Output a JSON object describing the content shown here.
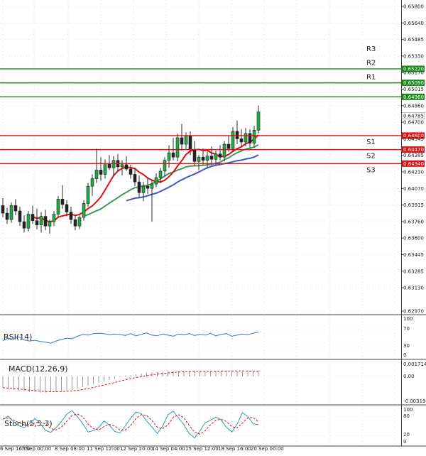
{
  "chart_data": {
    "type": "candlestick",
    "price_axis": {
      "ticks": [
        "0.65800",
        "0.65640",
        "0.65485",
        "0.65330",
        "0.65170",
        "0.65015",
        "0.64860",
        "0.64700",
        "0.64545",
        "0.64385",
        "0.64230",
        "0.64070",
        "0.63915",
        "0.63760",
        "0.63600",
        "0.63445",
        "0.63285",
        "0.63130",
        "0.62970"
      ],
      "ylim": [
        0.6297,
        0.658
      ],
      "current_price": "0.64785"
    },
    "time_axis": {
      "labels": [
        "6 Sep 16:00",
        "7 Sep 00:00",
        "8 Sep 08:00",
        "11 Sep 12:00",
        "12 Sep 20:00",
        "14 Sep 04:00",
        "15 Sep 12:00",
        "18 Sep 16:00",
        "20 Sep 00:00"
      ]
    },
    "levels": [
      {
        "label": "R3",
        "value": 0.6522,
        "tag": "0.65220",
        "color": "#1a8a1a"
      },
      {
        "label": "R2",
        "value": 0.6509,
        "tag": "0.65090",
        "color": "#1a8a1a"
      },
      {
        "label": "R1",
        "value": 0.6496,
        "tag": "0.64960",
        "color": "#1a8a1a"
      },
      {
        "label": "S1",
        "value": 0.646,
        "tag": "0.64600",
        "color": "#dd1111"
      },
      {
        "label": "S2",
        "value": 0.6447,
        "tag": "0.64470",
        "color": "#dd1111"
      },
      {
        "label": "S3",
        "value": 0.6434,
        "tag": "0.64340",
        "color": "#dd1111"
      }
    ],
    "candles": [
      [
        0.6395,
        0.6402,
        0.6384,
        0.6388
      ],
      [
        0.6388,
        0.6393,
        0.6378,
        0.6382
      ],
      [
        0.6382,
        0.6398,
        0.6379,
        0.6395
      ],
      [
        0.6395,
        0.6401,
        0.6386,
        0.639
      ],
      [
        0.639,
        0.6394,
        0.6376,
        0.638
      ],
      [
        0.638,
        0.6386,
        0.637,
        0.6374
      ],
      [
        0.6374,
        0.639,
        0.6371,
        0.6387
      ],
      [
        0.6387,
        0.6395,
        0.6378,
        0.6381
      ],
      [
        0.6381,
        0.6392,
        0.6373,
        0.6377
      ],
      [
        0.6377,
        0.6389,
        0.637,
        0.6385
      ],
      [
        0.6385,
        0.6391,
        0.6372,
        0.6376
      ],
      [
        0.6376,
        0.6382,
        0.6369,
        0.638
      ],
      [
        0.638,
        0.639,
        0.6376,
        0.6387
      ],
      [
        0.6387,
        0.6404,
        0.6384,
        0.6401
      ],
      [
        0.6401,
        0.6414,
        0.6392,
        0.6396
      ],
      [
        0.6396,
        0.64,
        0.6385,
        0.6389
      ],
      [
        0.6389,
        0.6394,
        0.6378,
        0.6382
      ],
      [
        0.6382,
        0.6386,
        0.6372,
        0.6376
      ],
      [
        0.6376,
        0.6386,
        0.6373,
        0.6384
      ],
      [
        0.6384,
        0.64,
        0.6381,
        0.6397
      ],
      [
        0.6397,
        0.6416,
        0.6394,
        0.6413
      ],
      [
        0.6413,
        0.6424,
        0.6404,
        0.642
      ],
      [
        0.642,
        0.6448,
        0.6416,
        0.6428
      ],
      [
        0.6428,
        0.644,
        0.6418,
        0.6424
      ],
      [
        0.6424,
        0.6438,
        0.642,
        0.6434
      ],
      [
        0.6434,
        0.6442,
        0.6428,
        0.643
      ],
      [
        0.643,
        0.6441,
        0.6422,
        0.6437
      ],
      [
        0.6437,
        0.6443,
        0.6427,
        0.6431
      ],
      [
        0.6431,
        0.6437,
        0.6423,
        0.6433
      ],
      [
        0.6433,
        0.6441,
        0.6427,
        0.6429
      ],
      [
        0.6429,
        0.6433,
        0.642,
        0.6424
      ],
      [
        0.6424,
        0.643,
        0.6413,
        0.6417
      ],
      [
        0.6417,
        0.6423,
        0.6402,
        0.6407
      ],
      [
        0.6407,
        0.6417,
        0.6399,
        0.6413
      ],
      [
        0.6413,
        0.6421,
        0.6406,
        0.6411
      ],
      [
        0.6411,
        0.6419,
        0.638,
        0.6415
      ],
      [
        0.6415,
        0.6425,
        0.6412,
        0.6421
      ],
      [
        0.6421,
        0.643,
        0.6416,
        0.6427
      ],
      [
        0.6427,
        0.644,
        0.6422,
        0.6437
      ],
      [
        0.6437,
        0.6451,
        0.643,
        0.6444
      ],
      [
        0.6444,
        0.6458,
        0.6437,
        0.644
      ],
      [
        0.644,
        0.6462,
        0.6436,
        0.6458
      ],
      [
        0.6458,
        0.6471,
        0.6446,
        0.6452
      ],
      [
        0.6452,
        0.6463,
        0.6447,
        0.646
      ],
      [
        0.646,
        0.6464,
        0.6442,
        0.6447
      ],
      [
        0.6447,
        0.6455,
        0.6432,
        0.6436
      ],
      [
        0.6436,
        0.6442,
        0.6428,
        0.644
      ],
      [
        0.644,
        0.6448,
        0.6433,
        0.6437
      ],
      [
        0.6437,
        0.6445,
        0.643,
        0.6441
      ],
      [
        0.6441,
        0.645,
        0.6434,
        0.6438
      ],
      [
        0.6438,
        0.6446,
        0.6433,
        0.6443
      ],
      [
        0.6443,
        0.6451,
        0.6437,
        0.644
      ],
      [
        0.644,
        0.6455,
        0.6436,
        0.6452
      ],
      [
        0.6452,
        0.646,
        0.6445,
        0.6448
      ],
      [
        0.6448,
        0.6468,
        0.6445,
        0.6464
      ],
      [
        0.6464,
        0.6474,
        0.6452,
        0.6457
      ],
      [
        0.6457,
        0.6466,
        0.645,
        0.6454
      ],
      [
        0.6454,
        0.6467,
        0.645,
        0.6462
      ],
      [
        0.6462,
        0.6466,
        0.6449,
        0.6453
      ],
      [
        0.6453,
        0.6469,
        0.6449,
        0.6465
      ],
      [
        0.6465,
        0.6488,
        0.6462,
        0.6482
      ]
    ],
    "indicators": {
      "rsi": {
        "label": "RSI(14)",
        "ticks": [
          "100",
          "70",
          "30",
          "0"
        ],
        "values": [
          45,
          52,
          49,
          55,
          47,
          44,
          46,
          43,
          41,
          38,
          44,
          48,
          52,
          50,
          57,
          62,
          60,
          64,
          65,
          64,
          61,
          63,
          62,
          59,
          64,
          58,
          62,
          66,
          60,
          58,
          63,
          60,
          57,
          63,
          61,
          64,
          59,
          62,
          60,
          65,
          58,
          62,
          64,
          57,
          60,
          63,
          61,
          65,
          68
        ]
      },
      "macd": {
        "label": "MACD(12,26,9)",
        "ticks": [
          "0.001714",
          "0.00",
          "-0.003195"
        ],
        "histogram": [
          -0.0016,
          -0.0018,
          -0.0019,
          -0.002,
          -0.0021,
          -0.0022,
          -0.0022,
          -0.0023,
          -0.0023,
          -0.0022,
          -0.0022,
          -0.0021,
          -0.002,
          -0.0019,
          -0.0017,
          -0.0015,
          -0.0013,
          -0.0011,
          -0.0009,
          -0.0007,
          -0.0005,
          -0.0003,
          -0.0001,
          0.0001,
          0.0002,
          0.0003,
          0.0004,
          0.0005,
          0.0006,
          0.0006,
          0.0007,
          0.0007,
          0.0008,
          0.0008,
          0.0008,
          0.0008,
          0.0008,
          0.0008,
          0.0007,
          0.0007,
          0.0008,
          0.0008,
          0.0008,
          0.0008,
          0.0008,
          0.0008,
          0.0007,
          0.0007,
          0.0008
        ]
      },
      "stoch": {
        "label": "Stoch(5,5,3)",
        "ticks": [
          "100",
          "80",
          "20",
          "0"
        ],
        "k": [
          70,
          80,
          64,
          52,
          47,
          58,
          73,
          60,
          39,
          33,
          47,
          64,
          85,
          96,
          78,
          59,
          34,
          38,
          47,
          66,
          54,
          36,
          32,
          52,
          74,
          92,
          87,
          66,
          49,
          30,
          51,
          84,
          94,
          75,
          55,
          30,
          17,
          37,
          61,
          68,
          77,
          69,
          48,
          34,
          57,
          90,
          79,
          58,
          55
        ],
        "d": [
          72,
          74,
          69,
          61,
          55,
          53,
          60,
          64,
          57,
          44,
          40,
          48,
          65,
          82,
          86,
          78,
          57,
          44,
          40,
          50,
          56,
          52,
          40,
          40,
          53,
          73,
          84,
          82,
          67,
          48,
          43,
          55,
          76,
          84,
          75,
          53,
          34,
          28,
          38,
          55,
          68,
          71,
          64,
          50,
          46,
          60,
          75,
          76,
          64
        ]
      }
    }
  }
}
